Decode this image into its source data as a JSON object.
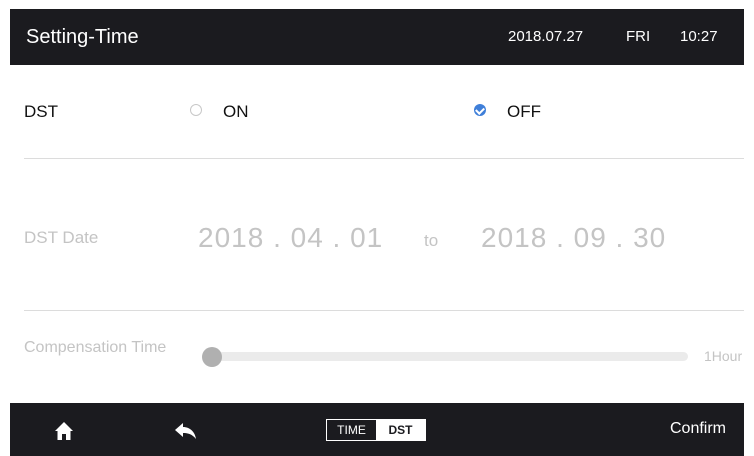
{
  "header": {
    "title": "Setting-Time",
    "date": "2018.07.27",
    "day": "FRI",
    "time": "10:27"
  },
  "dst": {
    "label": "DST",
    "options": [
      {
        "label": "ON",
        "selected": false
      },
      {
        "label": "OFF",
        "selected": true
      }
    ]
  },
  "dst_date": {
    "label": "DST Date",
    "start": "2018 . 04 . 01",
    "separator": "to",
    "end": "2018 . 09 . 30"
  },
  "compensation": {
    "label": "Compensation Time",
    "max_label": "1Hour",
    "value_fraction": 0.0
  },
  "footer": {
    "segment": {
      "time_label": "TIME",
      "dst_label": "DST",
      "active": "DST"
    },
    "confirm_label": "Confirm"
  },
  "colors": {
    "bar_background": "#1b1b1f",
    "accent": "#3f7fd9",
    "disabled_text": "#c4c4c4"
  },
  "icons": [
    "home-icon",
    "back-icon",
    "radio-unchecked-icon",
    "radio-checked-icon"
  ]
}
